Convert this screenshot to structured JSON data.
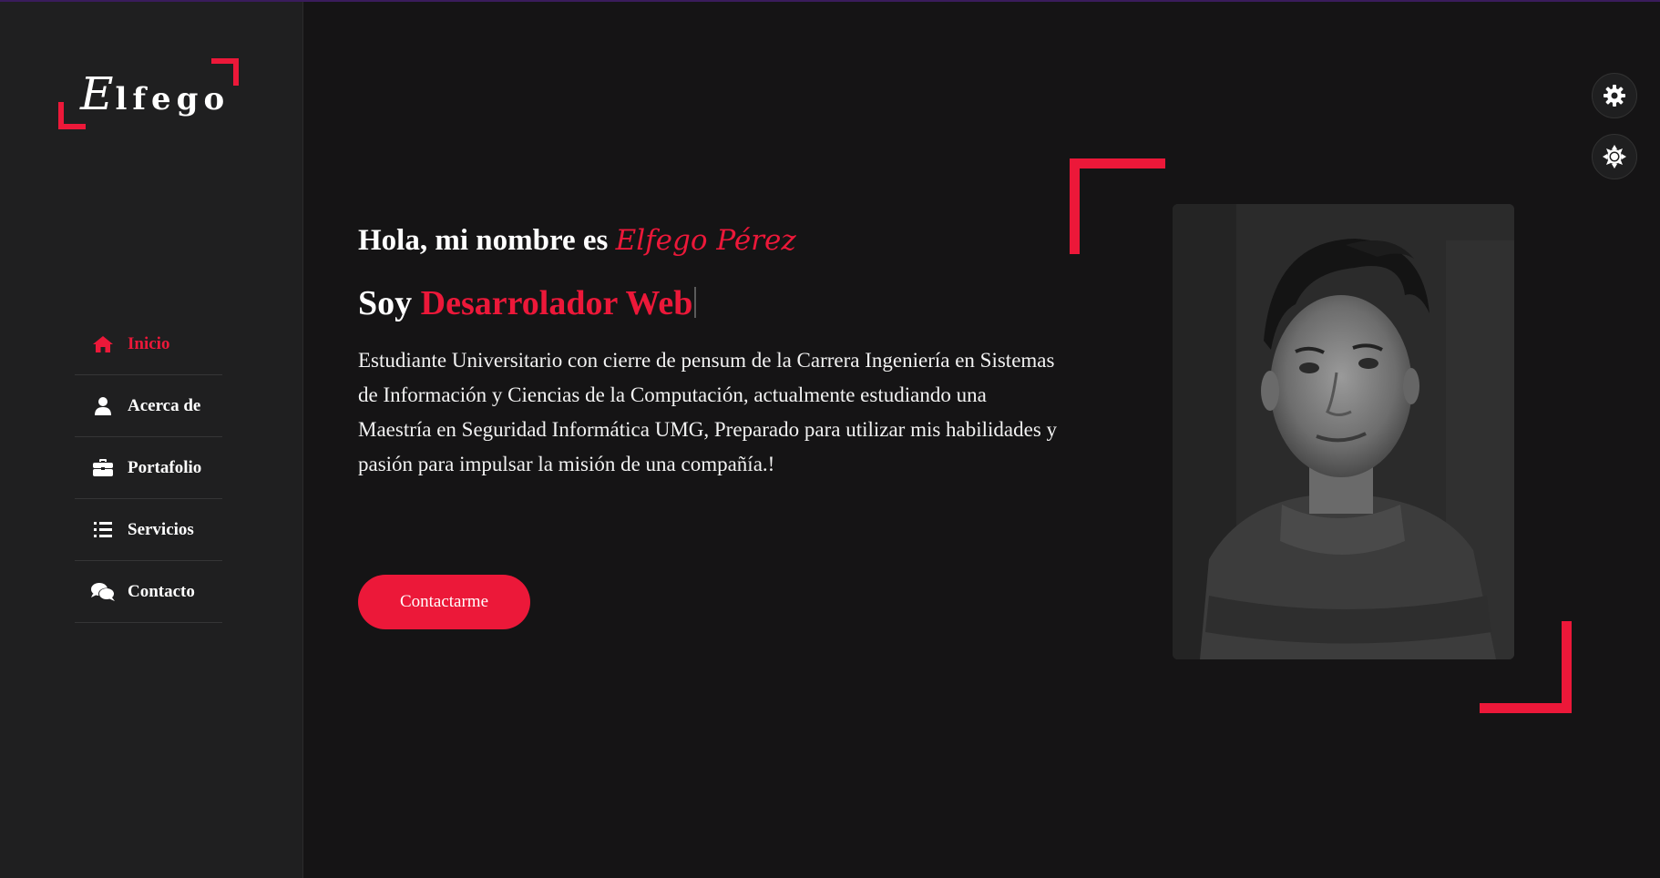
{
  "logo": {
    "first_letter": "E",
    "rest": "lfego"
  },
  "nav": {
    "items": [
      {
        "label": "Inicio",
        "icon": "home-icon",
        "active": true
      },
      {
        "label": "Acerca de",
        "icon": "user-icon",
        "active": false
      },
      {
        "label": "Portafolio",
        "icon": "briefcase-icon",
        "active": false
      },
      {
        "label": "Servicios",
        "icon": "list-icon",
        "active": false
      },
      {
        "label": "Contacto",
        "icon": "comments-icon",
        "active": false
      }
    ]
  },
  "hero": {
    "greeting": "Hola, mi nombre es ",
    "name": "Elfego Pérez",
    "role_prefix": "Soy ",
    "role": "Desarrolador Web",
    "description": "Estudiante Universitario con cierre de pensum de la Carrera Ingeniería en Sistemas de Información y Ciencias de la Computación, actualmente estudiando una Maestría en Seguridad Informática UMG, Preparado para utilizar mis habilidades y pasión para impulsar la misión de una compañía.!",
    "cta_label": "Contactarme"
  },
  "photo": {
    "icon": "profile-photo"
  },
  "settings": {
    "icons": [
      "gear-icon",
      "theme-toggle-icon"
    ]
  },
  "colors": {
    "accent": "#ec1839",
    "background": "#151415",
    "sidebar": "#1f1f20"
  }
}
